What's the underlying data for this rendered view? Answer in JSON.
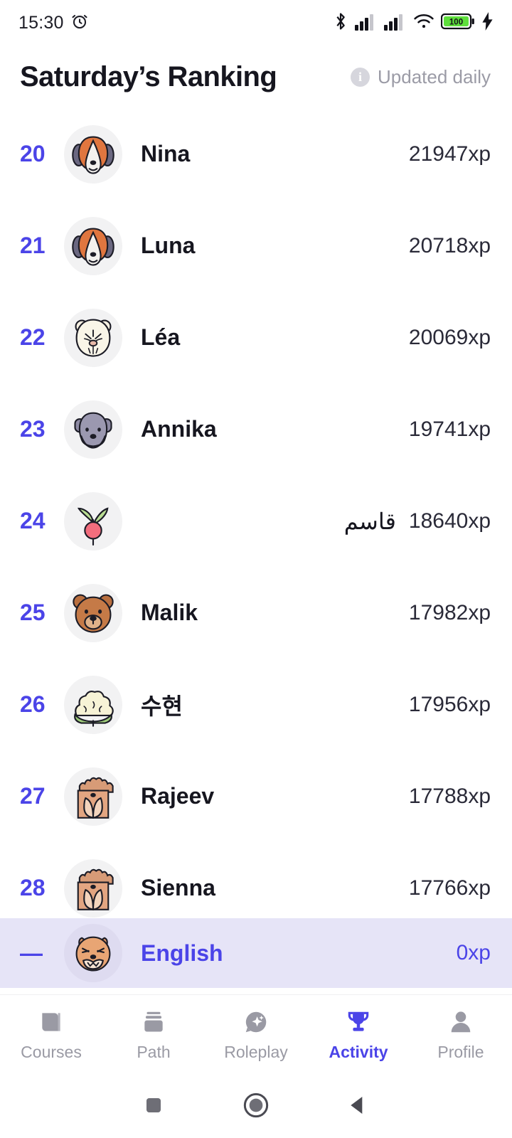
{
  "status_bar": {
    "time": "15:30",
    "alarm_icon": "alarm-icon",
    "bluetooth_icon": "bluetooth-icon",
    "signal_one_icon": "signal-bars-icon",
    "signal_two_icon": "signal-bars-icon",
    "wifi_icon": "wifi-icon",
    "battery_level": "100",
    "charging_icon": "charging-bolt-icon"
  },
  "header": {
    "title": "Saturday’s Ranking",
    "updated_label": "Updated daily",
    "info_icon_glyph": "i"
  },
  "colors": {
    "accent": "#4b44e8",
    "text_primary": "#16161f",
    "text_muted": "#9b9ba6",
    "xp_text": "#2a2a38",
    "avatar_bg": "#f2f2f3",
    "self_row_bg": "#e6e4f7",
    "battery_green": "#5ede3c"
  },
  "leaderboard": {
    "rows": [
      {
        "rank": "20",
        "name": "Nina",
        "xp": "21947xp",
        "avatar": "beagle-dog-avatar",
        "rtl": false
      },
      {
        "rank": "21",
        "name": "Luna",
        "xp": "20718xp",
        "avatar": "beagle-dog-avatar",
        "rtl": false
      },
      {
        "rank": "22",
        "name": "Léa",
        "xp": "20069xp",
        "avatar": "hamster-avatar",
        "rtl": false
      },
      {
        "rank": "23",
        "name": "Annika",
        "xp": "19741xp",
        "avatar": "grey-dog-avatar",
        "rtl": false
      },
      {
        "rank": "24",
        "name": "قاسم",
        "xp": "18640xp",
        "avatar": "radish-avatar",
        "rtl": true
      },
      {
        "rank": "25",
        "name": "Malik",
        "xp": "17982xp",
        "avatar": "bear-avatar",
        "rtl": false
      },
      {
        "rank": "26",
        "name": "수현",
        "xp": "17956xp",
        "avatar": "cauliflower-avatar",
        "rtl": false
      },
      {
        "rank": "27",
        "name": "Rajeev",
        "xp": "17788xp",
        "avatar": "fluffy-dog-avatar",
        "rtl": false
      },
      {
        "rank": "28",
        "name": "Sienna",
        "xp": "17766xp",
        "avatar": "fluffy-dog-avatar",
        "rtl": false
      }
    ]
  },
  "self_row": {
    "rank": "—",
    "name": "English",
    "xp": "0xp",
    "avatar": "lion-cat-avatar"
  },
  "tabs": [
    {
      "label": "Courses",
      "icon": "book-icon",
      "active": false
    },
    {
      "label": "Path",
      "icon": "stack-icon",
      "active": false
    },
    {
      "label": "Roleplay",
      "icon": "chat-spark-icon",
      "active": false
    },
    {
      "label": "Activity",
      "icon": "trophy-icon",
      "active": true
    },
    {
      "label": "Profile",
      "icon": "person-icon",
      "active": false
    }
  ],
  "android_nav": {
    "recents_icon": "square-recents-icon",
    "home_icon": "circle-home-icon",
    "back_icon": "triangle-back-icon"
  }
}
